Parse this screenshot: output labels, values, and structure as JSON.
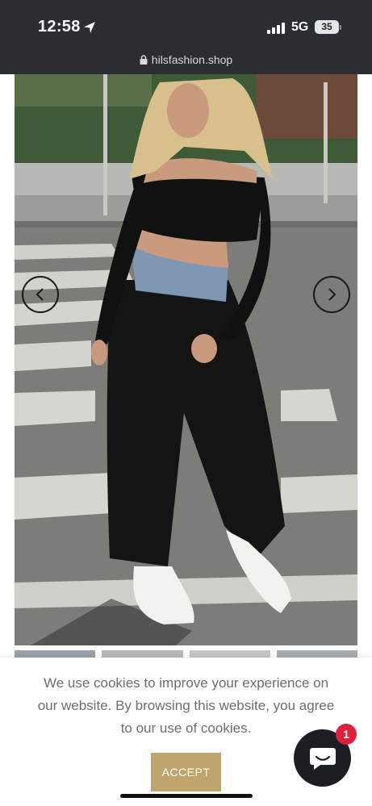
{
  "status_bar": {
    "time": "12:58",
    "network": "5G",
    "battery": "35"
  },
  "browser": {
    "url": "hilsfashion.shop"
  },
  "gallery": {
    "prev_icon": "chevron-left-icon",
    "next_icon": "chevron-right-icon",
    "thumbnail_count": 4
  },
  "cookie_banner": {
    "message": "We use cookies to improve your experience on our website. By browsing this website, you agree to our use of cookies.",
    "accept_label": "ACCEPT",
    "accept_color": "#bfa46d"
  },
  "chat": {
    "icon": "chat-bubble-icon",
    "badge": "1",
    "badge_color": "#e0203a"
  }
}
